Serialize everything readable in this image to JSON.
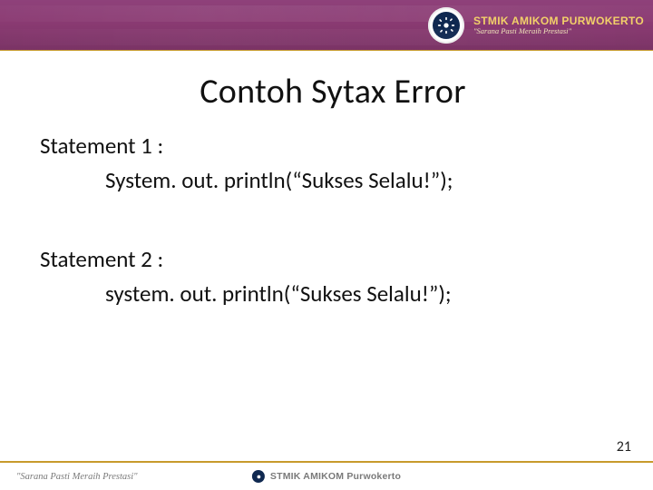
{
  "header": {
    "brand_title": "STMIK AMIKOM PURWOKERTO",
    "brand_tagline": "\"Sarana Pasti Meraih Prestasi\""
  },
  "slide": {
    "title": "Contoh Sytax Error",
    "statement1_label": "Statement 1 :",
    "statement1_code": "System. out. println(“Sukses Selalu!”);",
    "statement2_label": "Statement 2 :",
    "statement2_code": "system. out. println(“Sukses Selalu!”);"
  },
  "footer": {
    "tagline": "\"Sarana Pasti Meraih Prestasi\"",
    "center_text": "STMIK AMIKOM Purwokerto"
  },
  "page_number": "21"
}
